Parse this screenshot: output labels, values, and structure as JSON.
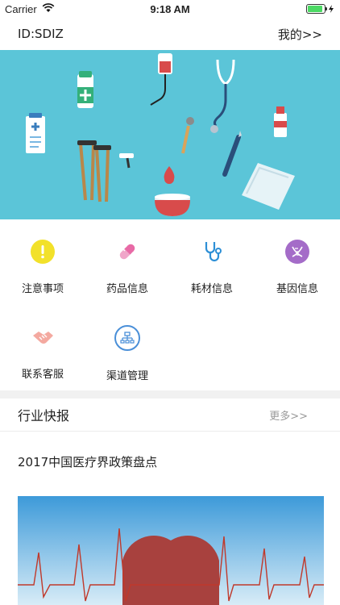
{
  "status_bar": {
    "carrier": "Carrier",
    "time": "9:18 AM",
    "battery_level": 0.9
  },
  "nav": {
    "user_id": "ID:SDIZ",
    "mine_link": "我的>>"
  },
  "categories": [
    {
      "label": "注意事项",
      "icon": "exclamation-icon",
      "color": "#f2e12a"
    },
    {
      "label": "药品信息",
      "icon": "pill-icon",
      "color": "#f0a6c9"
    },
    {
      "label": "耗材信息",
      "icon": "stethoscope-icon",
      "color": "#2d8fd6"
    },
    {
      "label": "基因信息",
      "icon": "dna-icon",
      "color": "#a46cc8"
    },
    {
      "label": "联系客服",
      "icon": "handshake-icon",
      "color": "#f4a9a0"
    },
    {
      "label": "渠道管理",
      "icon": "org-chart-icon",
      "color": "#4a8fd8"
    }
  ],
  "news": {
    "section_title": "行业快报",
    "more_link": "更多>>"
  },
  "articles": [
    {
      "title": "2017中国医疗界政策盘点"
    }
  ],
  "colors": {
    "banner_bg": "#5bc5d8",
    "heart": "#a8413e",
    "article_bg": "#4fa9e0"
  }
}
